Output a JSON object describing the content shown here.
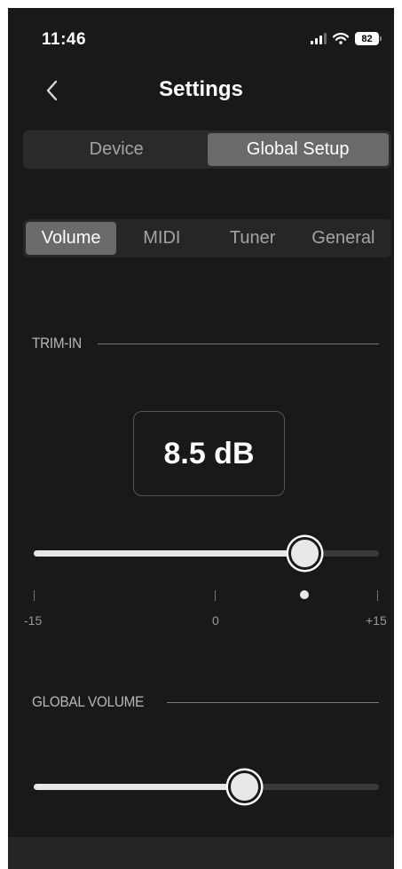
{
  "status_bar": {
    "time": "11:46",
    "battery": "82"
  },
  "header": {
    "title": "Settings"
  },
  "top_tabs": [
    {
      "label": "Device",
      "active": false
    },
    {
      "label": "Global Setup",
      "active": true
    }
  ],
  "sub_tabs": [
    {
      "label": "Volume",
      "active": true
    },
    {
      "label": "MIDI",
      "active": false
    },
    {
      "label": "Tuner",
      "active": false
    },
    {
      "label": "General",
      "active": false
    }
  ],
  "trim_in": {
    "label": "TRIM-IN",
    "value_display": "8.5 dB",
    "value": 8.5,
    "min": -15,
    "max": 15,
    "scale_labels": {
      "min": "-15",
      "mid": "0",
      "max": "+15"
    }
  },
  "global_volume": {
    "label": "GLOBAL VOLUME",
    "level": 0.61
  },
  "colors": {
    "background": "#191919",
    "accent": "#e6e6e6",
    "segment_active": "#6a6a6a"
  }
}
